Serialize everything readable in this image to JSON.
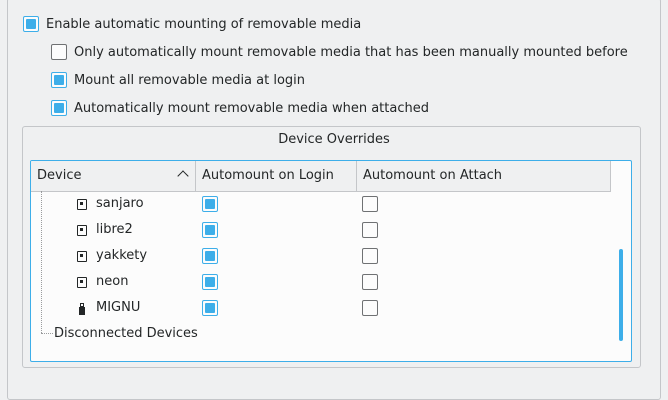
{
  "options": {
    "enable_automount": {
      "label": "Enable automatic mounting of removable media",
      "checked": true
    },
    "only_manually_mounted": {
      "label": "Only automatically mount removable media that has been manually mounted before",
      "checked": false
    },
    "mount_at_login": {
      "label": "Mount all removable media at login",
      "checked": true
    },
    "mount_when_attached": {
      "label": "Automatically mount removable media when attached",
      "checked": true
    }
  },
  "device_overrides": {
    "title": "Device Overrides",
    "columns": {
      "device": "Device",
      "login": "Automount on Login",
      "attach": "Automount on Attach"
    },
    "rows": [
      {
        "name": "sanjaro",
        "icon": "hard-drive-icon",
        "login": true,
        "attach": false
      },
      {
        "name": "libre2",
        "icon": "hard-drive-icon",
        "login": true,
        "attach": false
      },
      {
        "name": "yakkety",
        "icon": "hard-drive-icon",
        "login": true,
        "attach": false
      },
      {
        "name": "neon",
        "icon": "hard-drive-icon",
        "login": true,
        "attach": false
      },
      {
        "name": "MIGNU",
        "icon": "usb-drive-icon",
        "login": true,
        "attach": false
      }
    ],
    "group_label": "Disconnected Devices"
  },
  "colors": {
    "accent": "#3daee9",
    "window_bg": "#eff0f1",
    "view_bg": "#fcfcfc"
  }
}
